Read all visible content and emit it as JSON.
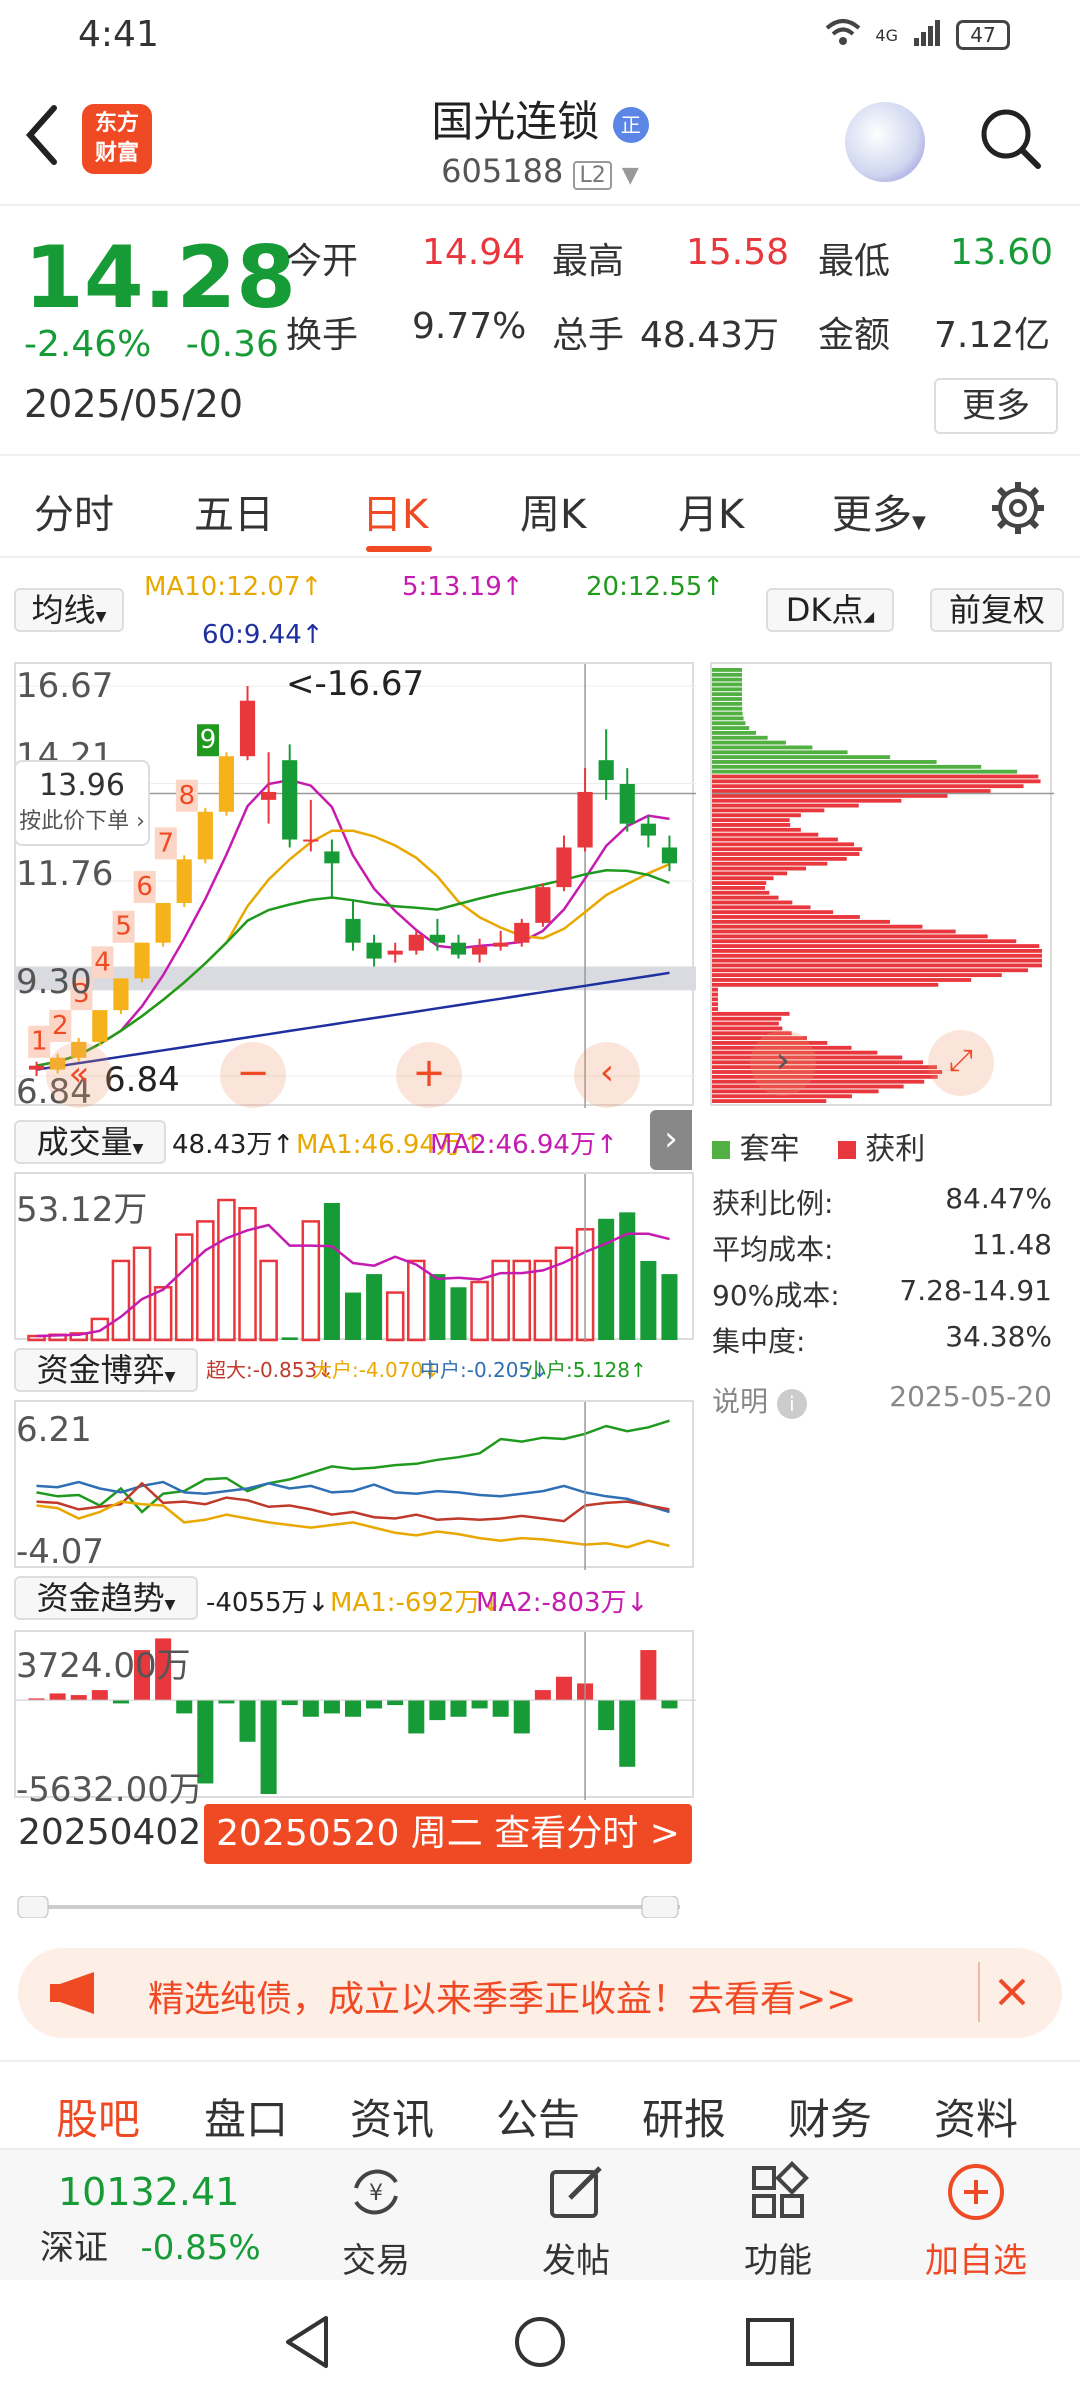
{
  "status": {
    "time": "4:41",
    "network": "4G",
    "battery": "47"
  },
  "header": {
    "stock_name": "国光连锁",
    "badge": "正",
    "stock_code": "605188",
    "level": "L2",
    "logo_line1": "东方",
    "logo_line2": "财富"
  },
  "quote": {
    "price": "14.28",
    "change_pct": "-2.46%",
    "change": "-0.36",
    "date": "2025/05/20",
    "open_label": "今开",
    "open": "14.94",
    "high_label": "最高",
    "high": "15.58",
    "low_label": "最低",
    "low": "13.60",
    "turnover_label": "换手",
    "turnover": "9.77%",
    "volume_label": "总手",
    "volume": "48.43万",
    "amount_label": "金额",
    "amount": "7.12亿",
    "more": "更多"
  },
  "tabs": [
    "分时",
    "五日",
    "日K",
    "周K",
    "月K",
    "更多"
  ],
  "active_tab": "日K",
  "indicators": {
    "ma_selector": "均线",
    "ma10": "MA10:12.07↑",
    "ma5": "5:13.19↑",
    "ma20": "20:12.55↑",
    "ma60": "60:9.44↑",
    "dk_button": "DK点",
    "adjust_button": "前复权"
  },
  "kline": {
    "y_labels": [
      "16.67",
      "14.21",
      "11.76",
      "9.30",
      "6.84"
    ],
    "peak_label": "<-16.67",
    "low_label": "6.84",
    "tooltip_value": "13.96",
    "tooltip_text": "按此价下单",
    "seq_numbers": [
      "1",
      "2",
      "3",
      "4",
      "5",
      "6",
      "7",
      "8",
      "9"
    ]
  },
  "volume": {
    "selector": "成交量",
    "value": "48.43万↑",
    "ma1": "MA1:46.94万↑",
    "ma2": "MA2:46.94万↑",
    "max_label": "53.12万"
  },
  "fund_game": {
    "selector": "资金博弈",
    "super": "超大:-0.853↓",
    "large": "大户:-4.070↓",
    "mid": "中户:-0.205↓",
    "small": "小户:5.128↑",
    "max_label": "6.21",
    "min_label": "-4.07"
  },
  "fund_trend": {
    "selector": "资金趋势",
    "value": "-4055万↓",
    "ma1": "MA1:-692万↓",
    "ma2": "MA2:-803万↓",
    "max_label": "3724.00万",
    "min_label": "-5632.00万"
  },
  "footer_chart": {
    "start_date": "20250402",
    "button": "20250520 周二 查看分时 >"
  },
  "dk_panel": {
    "legend_trapped": "套牢",
    "legend_profit": "获利",
    "stats": [
      {
        "label": "获利比例:",
        "value": "84.47%"
      },
      {
        "label": "平均成本:",
        "value": "11.48"
      },
      {
        "label": "90%成本:",
        "value": "7.28-14.91"
      },
      {
        "label": "集中度:",
        "value": "34.38%"
      }
    ],
    "note": "说明",
    "note_date": "2025-05-20"
  },
  "banner": {
    "text": "精选纯债，成立以来季季正收益！去看看>>"
  },
  "bottom_tabs": [
    "股吧",
    "盘口",
    "资讯",
    "公告",
    "研报",
    "财务",
    "资料"
  ],
  "toolbar": {
    "index_value": "10132.41",
    "index_name": "深证",
    "index_change": "-0.85%",
    "trade": "交易",
    "post": "发帖",
    "function": "功能",
    "add_watch": "加自选"
  },
  "colors": {
    "up": "#e8373d",
    "down": "#179b37",
    "accent": "#f04a24"
  },
  "chart_data": {
    "type": "candlestick",
    "range": [
      "20250402",
      "20250520"
    ],
    "ylim": [
      6.84,
      16.67
    ],
    "candles": [
      {
        "o": 7.0,
        "c": 7.1,
        "h": 7.2,
        "l": 6.84
      },
      {
        "o": 7.0,
        "c": 7.3,
        "h": 7.4,
        "l": 6.9
      },
      {
        "o": 7.3,
        "c": 7.7,
        "h": 7.8,
        "l": 7.2
      },
      {
        "o": 7.7,
        "c": 8.5,
        "h": 8.5,
        "l": 7.6
      },
      {
        "o": 8.5,
        "c": 9.3,
        "h": 9.3,
        "l": 8.4
      },
      {
        "o": 9.3,
        "c": 10.2,
        "h": 10.2,
        "l": 9.2
      },
      {
        "o": 10.2,
        "c": 11.2,
        "h": 11.2,
        "l": 10.1
      },
      {
        "o": 11.2,
        "c": 12.3,
        "h": 12.4,
        "l": 11.1
      },
      {
        "o": 12.3,
        "c": 13.5,
        "h": 13.6,
        "l": 12.2
      },
      {
        "o": 13.5,
        "c": 14.9,
        "h": 15.0,
        "l": 13.4
      },
      {
        "o": 14.9,
        "c": 16.3,
        "h": 16.67,
        "l": 14.8
      },
      {
        "o": 13.8,
        "c": 14.0,
        "h": 15.0,
        "l": 13.2
      },
      {
        "o": 14.8,
        "c": 12.8,
        "h": 15.2,
        "l": 12.6
      },
      {
        "o": 12.8,
        "c": 12.8,
        "h": 13.8,
        "l": 12.5
      },
      {
        "o": 12.5,
        "c": 12.2,
        "h": 12.8,
        "l": 11.3
      },
      {
        "o": 10.8,
        "c": 10.2,
        "h": 11.3,
        "l": 10.0
      },
      {
        "o": 10.2,
        "c": 9.8,
        "h": 10.4,
        "l": 9.6
      },
      {
        "o": 9.9,
        "c": 10.0,
        "h": 10.2,
        "l": 9.7
      },
      {
        "o": 10.0,
        "c": 10.4,
        "h": 10.5,
        "l": 9.9
      },
      {
        "o": 10.4,
        "c": 10.2,
        "h": 10.8,
        "l": 10.0
      },
      {
        "o": 10.2,
        "c": 9.9,
        "h": 10.4,
        "l": 9.8
      },
      {
        "o": 9.9,
        "c": 10.1,
        "h": 10.3,
        "l": 9.7
      },
      {
        "o": 10.1,
        "c": 10.2,
        "h": 10.5,
        "l": 10.0
      },
      {
        "o": 10.2,
        "c": 10.7,
        "h": 10.8,
        "l": 10.1
      },
      {
        "o": 10.7,
        "c": 11.6,
        "h": 11.7,
        "l": 10.6
      },
      {
        "o": 11.6,
        "c": 12.6,
        "h": 12.9,
        "l": 11.5
      },
      {
        "o": 12.6,
        "c": 14.0,
        "h": 14.6,
        "l": 12.5
      },
      {
        "o": 14.8,
        "c": 14.3,
        "h": 15.58,
        "l": 13.8
      },
      {
        "o": 14.2,
        "c": 13.2,
        "h": 14.6,
        "l": 13.0
      },
      {
        "o": 13.2,
        "c": 12.9,
        "h": 13.4,
        "l": 12.6
      },
      {
        "o": 12.6,
        "c": 12.2,
        "h": 12.9,
        "l": 12.0
      }
    ],
    "volume": [
      1.5,
      2,
      2.5,
      8,
      30,
      35,
      20,
      40,
      45,
      53.12,
      50,
      30,
      1,
      45,
      52,
      18,
      25,
      18,
      30,
      25,
      20,
      22,
      30,
      30,
      30,
      35,
      42,
      46,
      48.43,
      30,
      25
    ]
  }
}
